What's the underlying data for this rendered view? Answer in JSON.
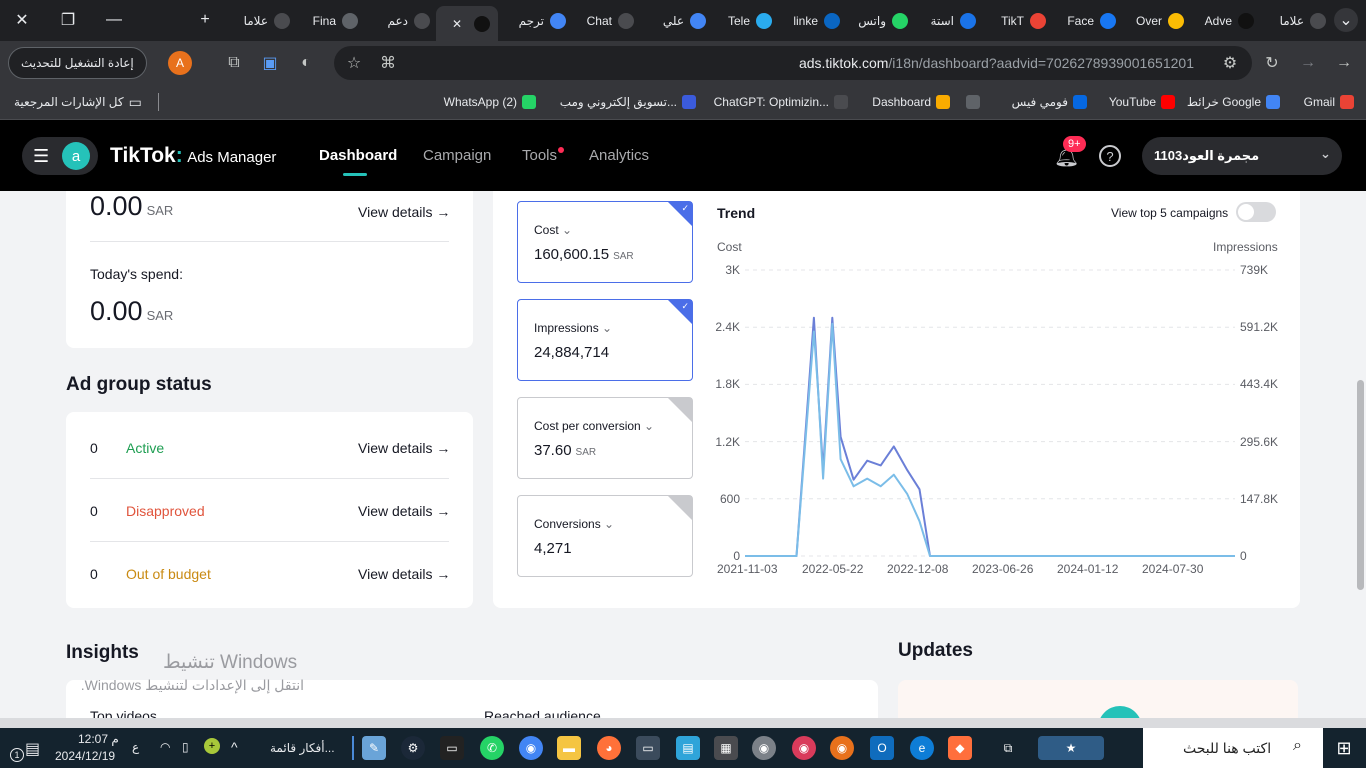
{
  "browser": {
    "tabs": [
      {
        "label": "علاما",
        "icon": "chrome-icon",
        "color": "#4a4b4f"
      },
      {
        "label": "Adve",
        "icon": "tiktok-icon",
        "color": "#111111"
      },
      {
        "label": "Over",
        "icon": "google-ads-icon",
        "color": "#fbbc04"
      },
      {
        "label": "Face",
        "icon": "facebook-icon",
        "color": "#1877f2"
      },
      {
        "label": "TikT",
        "icon": "gmail-icon",
        "color": "#ea4335"
      },
      {
        "label": "استة",
        "icon": "circle-blue-icon",
        "color": "#1a73e8"
      },
      {
        "label": "واتس",
        "icon": "whatsapp-icon",
        "color": "#25d366"
      },
      {
        "label": "linke",
        "icon": "linkedin-icon",
        "color": "#0a66c2"
      },
      {
        "label": "Tele",
        "icon": "telegram-icon",
        "color": "#2aabee"
      },
      {
        "label": "علي",
        "icon": "docs-icon",
        "color": "#4285f4"
      },
      {
        "label": "Chat",
        "icon": "chatgpt-icon",
        "color": "#4a4b4f"
      },
      {
        "label": "ترجم",
        "icon": "translate-icon",
        "color": "#4285f4"
      },
      {
        "label": "",
        "icon": "tiktok-icon",
        "color": "#111111"
      },
      {
        "label": "دعم",
        "icon": "chatgpt-icon",
        "color": "#4a4b4f"
      },
      {
        "label": "Fina",
        "icon": "globe-icon",
        "color": "#5f6368"
      },
      {
        "label": "علاما",
        "icon": "chrome-icon",
        "color": "#4a4b4f"
      }
    ],
    "url_host": "ads.tiktok.com",
    "url_path": "/i18n/dashboard?aadvid=7026278939001651201",
    "relaunch_label": "إعادة التشغيل للتحديث",
    "profile_letter": "A",
    "bookmarks": [
      {
        "label": "Gmail",
        "icon": "gmail-icon",
        "color": "#ea4335"
      },
      {
        "label": "خرائط Google",
        "icon": "google-icon",
        "color": "#4285f4"
      },
      {
        "label": "YouTube",
        "icon": "youtube-icon",
        "color": "#ff0000"
      },
      {
        "label": "فومي فيس",
        "icon": "meta-icon",
        "color": "#0668e1"
      },
      {
        "label": "",
        "icon": "globe-icon",
        "color": "#5f6368"
      },
      {
        "label": "Dashboard",
        "icon": "analytics-icon",
        "color": "#f9ab00"
      },
      {
        "label": "ChatGPT: Optimizin...",
        "icon": "chatgpt-icon",
        "color": "#4a4b4f"
      },
      {
        "label": "تسويق إلكتروني ومب...",
        "icon": "badge-icon",
        "color": "#3b5bdb"
      },
      {
        "label": "WhatsApp (2)",
        "icon": "whatsapp-icon",
        "color": "#25d366"
      }
    ],
    "all_bookmarks": "كل الإشارات المرجعية"
  },
  "app": {
    "avatar_letter": "a",
    "logo": "TikTok",
    "logo_sub": "Ads Manager",
    "nav": [
      "Dashboard",
      "Campaign",
      "Tools",
      "Analytics"
    ],
    "notif_badge": "9+",
    "account_name": "مجمرة العود1103"
  },
  "spend": {
    "top_value": "0.00",
    "unit": "SAR",
    "view_details": "View details →",
    "today_label": "Today's spend:",
    "today_value": "0.00"
  },
  "ad_group_status": {
    "title": "Ad group status",
    "rows": [
      {
        "count": "0",
        "label": "Active",
        "color": "#1e9e52",
        "link": "View details →"
      },
      {
        "count": "0",
        "label": "Disapproved",
        "color": "#e0543c",
        "link": "View details →"
      },
      {
        "count": "0",
        "label": "Out of budget",
        "color": "#c98a12",
        "link": "View details →"
      }
    ]
  },
  "metrics": [
    {
      "label": "Cost",
      "value": "160,600.15",
      "unit": "SAR",
      "selected": true
    },
    {
      "label": "Impressions",
      "value": "24,884,714",
      "unit": "",
      "selected": true
    },
    {
      "label": "Cost per conversion",
      "value": "37.60",
      "unit": "SAR",
      "selected": false
    },
    {
      "label": "Conversions",
      "value": "4,271",
      "unit": "",
      "selected": false
    }
  ],
  "trend": {
    "title": "Trend",
    "toggle_label": "View top 5 campaigns",
    "left_axis_title": "Cost",
    "right_axis_title": "Impressions",
    "left_ticks": [
      "3K",
      "2.4K",
      "1.8K",
      "1.2K",
      "600",
      "0"
    ],
    "right_ticks": [
      "739K",
      "591.2K",
      "443.4K",
      "295.6K",
      "147.8K",
      "0"
    ],
    "x_ticks": [
      "2021-11-03",
      "2022-05-22",
      "2022-12-08",
      "2023-06-26",
      "2024-01-12",
      "2024-07-30"
    ]
  },
  "chart_data": {
    "type": "line",
    "title": "Trend",
    "xlabel": "",
    "ylabel": "Cost",
    "y2label": "Impressions",
    "ylim": [
      0,
      3000
    ],
    "y2lim": [
      0,
      739000
    ],
    "x": [
      "2021-11-03",
      "2022-03-01",
      "2022-04-10",
      "2022-04-20",
      "2022-05-01",
      "2022-05-22",
      "2022-06-10",
      "2022-07-10",
      "2022-08-10",
      "2022-09-10",
      "2022-10-10",
      "2022-11-10",
      "2022-12-08",
      "2023-01-01",
      "2023-06-26",
      "2024-01-12",
      "2024-07-30",
      "2024-11-30"
    ],
    "series": [
      {
        "name": "Cost",
        "axis": "left",
        "color": "#6b7fd7",
        "values": [
          0,
          0,
          2500,
          1700,
          900,
          2500,
          1250,
          800,
          1000,
          950,
          1150,
          900,
          700,
          0,
          0,
          0,
          0,
          0
        ]
      },
      {
        "name": "Impressions",
        "axis": "right",
        "color": "#7bbde8",
        "values": [
          0,
          0,
          580000,
          420000,
          200000,
          600000,
          250000,
          180000,
          200000,
          180000,
          210000,
          160000,
          90000,
          0,
          0,
          0,
          0,
          0
        ]
      }
    ],
    "grid": true,
    "legend": "none"
  },
  "insights": {
    "title": "Insights",
    "top_videos": "Top videos",
    "reached": "Reached audience"
  },
  "updates": {
    "title": "Updates"
  },
  "watermark": {
    "line1": "تنشيط Windows",
    "line2": "انتقل إلى الإعدادات لتنشيط Windows."
  },
  "taskbar": {
    "search_placeholder": "اكتب هنا للبحث",
    "time": "12:07 م",
    "date": "2024/12/19",
    "lang": "ع",
    "app_label": "أفكار قائمة..."
  }
}
